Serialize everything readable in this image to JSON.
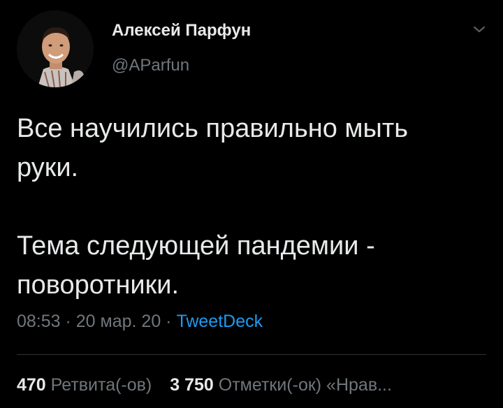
{
  "author": {
    "name": "Алексей Парфун",
    "handle": "@AParfun",
    "avatar_icon": "profile-photo"
  },
  "menu_icon": "chevron-down-icon",
  "tweet": {
    "paragraphs": [
      "Все научились правильно мыть\nруки.",
      "Тема следующей пандемии -\nповоротники."
    ]
  },
  "meta": {
    "time": "08:53",
    "separator1": " · ",
    "date": "20 мар. 20",
    "separator2": " · ",
    "source": "TweetDeck"
  },
  "stats": {
    "retweets_count": "470",
    "retweets_label": "Ретвита(-ов)",
    "likes_count": "3 750",
    "likes_label": "Отметки(-ок) «Нрав..."
  },
  "colors": {
    "background": "#000000",
    "primary_text": "#e7e9ea",
    "secondary_text": "#71767b",
    "link": "#1d9bf0",
    "divider": "#2f3336"
  }
}
